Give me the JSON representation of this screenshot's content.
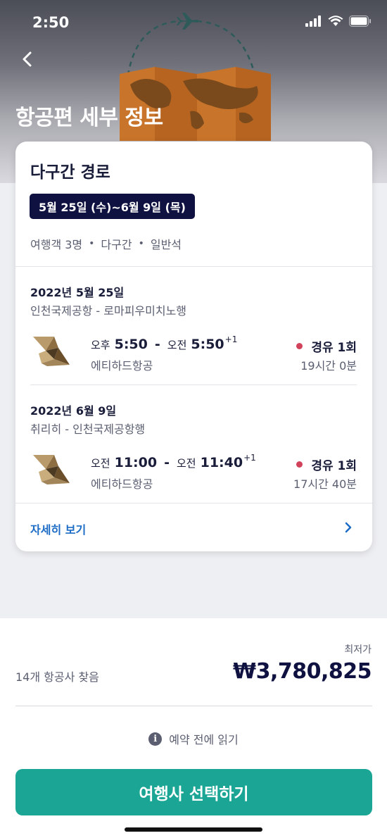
{
  "status_bar": {
    "time": "2:50"
  },
  "header": {
    "title": "항공편 세부 정보"
  },
  "trip": {
    "route_type": "다구간 경로",
    "date_range": "5월 25일 (수)~6월 9일 (목)",
    "meta": [
      "여행객 3명",
      "다구간",
      "일반석"
    ],
    "meta_separator": "•"
  },
  "legs": [
    {
      "date": "2022년 5월 25일",
      "route": "인천국제공항 - 로마피우미치노행",
      "depart_ampm": "오후",
      "depart_time": "5:50",
      "dash": "-",
      "arrive_ampm": "오전",
      "arrive_time": "5:50",
      "day_offset": "+1",
      "airline": "에티하드항공",
      "stops": "경유 1회",
      "duration": "19시간 0분"
    },
    {
      "date": "2022년 6월 9일",
      "route": "취리히 - 인천국제공항행",
      "depart_ampm": "오전",
      "depart_time": "11:00",
      "dash": "-",
      "arrive_ampm": "오전",
      "arrive_time": "11:40",
      "day_offset": "+1",
      "airline": "에티하드항공",
      "stops": "경유 1회",
      "duration": "17시간 40분"
    }
  ],
  "details_link": "자세히 보기",
  "summary": {
    "lowest_label": "최저가",
    "airlines_found": "14개 항공사 찾음",
    "price": "₩3,780,825"
  },
  "notice": {
    "icon": "info-icon",
    "text": "예약 전에 읽기"
  },
  "cta": {
    "label": "여행사 선택하기"
  },
  "colors": {
    "accent": "#1aa595",
    "link": "#1d6cc6",
    "navy": "#0f1140",
    "stop_dot": "#d1435b"
  }
}
